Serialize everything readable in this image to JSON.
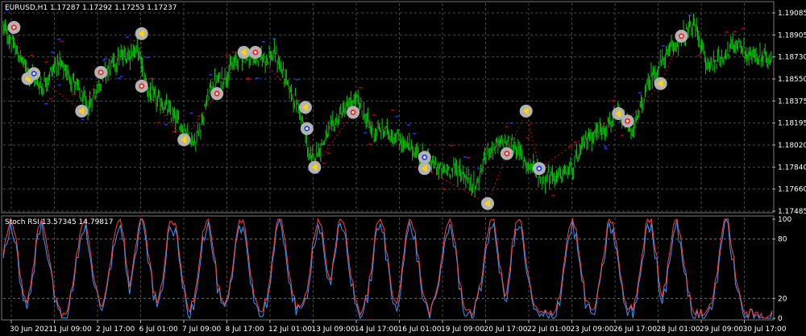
{
  "chart_data": [
    {
      "type": "candlestick",
      "title": "EURUSD,H1  1.17287 1.17292 1.17253 1.17237",
      "symbol": "EURUSD",
      "timeframe": "H1",
      "ohlc_readout": [
        "1.17287",
        "1.17292",
        "1.17253",
        "1.17237"
      ],
      "ylim": [
        1.17485,
        1.19085
      ],
      "y_ticks": [
        "1.19085",
        "1.18905",
        "1.18730",
        "1.18550",
        "1.18375",
        "1.18195",
        "1.18020",
        "1.17840",
        "1.17660",
        "1.17485"
      ],
      "x_ticks": [
        "30 Jun 2021",
        "1 Jul 09:00",
        "2 Jul 17:00",
        "6 Jul 01:00",
        "7 Jul 09:00",
        "8 Jul 17:00",
        "12 Jul 01:00",
        "13 Jul 09:00",
        "14 Jul 17:00",
        "16 Jul 01:00",
        "19 Jul 09:00",
        "20 Jul 17:00",
        "22 Jul 01:00",
        "23 Jul 09:00",
        "26 Jul 17:00",
        "28 Jul 01:00",
        "29 Jul 09:00",
        "30 Jul 17:00"
      ],
      "grid": true,
      "price_path": [
        [
          0,
          1.1893
        ],
        [
          0.03,
          1.186
        ],
        [
          0.05,
          1.1845
        ],
        [
          0.07,
          1.1865
        ],
        [
          0.09,
          1.1852
        ],
        [
          0.11,
          1.1828
        ],
        [
          0.13,
          1.1855
        ],
        [
          0.15,
          1.1868
        ],
        [
          0.175,
          1.1875
        ],
        [
          0.19,
          1.184
        ],
        [
          0.21,
          1.183
        ],
        [
          0.235,
          1.1812
        ],
        [
          0.25,
          1.18
        ],
        [
          0.27,
          1.1845
        ],
        [
          0.29,
          1.1855
        ],
        [
          0.31,
          1.1872
        ],
        [
          0.33,
          1.1868
        ],
        [
          0.355,
          1.187
        ],
        [
          0.375,
          1.184
        ],
        [
          0.385,
          1.1828
        ],
        [
          0.4,
          1.1785
        ],
        [
          0.42,
          1.1805
        ],
        [
          0.44,
          1.1825
        ],
        [
          0.46,
          1.1835
        ],
        [
          0.48,
          1.181
        ],
        [
          0.5,
          1.181
        ],
        [
          0.52,
          1.18
        ],
        [
          0.545,
          1.179
        ],
        [
          0.57,
          1.1778
        ],
        [
          0.59,
          1.178
        ],
        [
          0.615,
          1.1765
        ],
        [
          0.63,
          1.1795
        ],
        [
          0.66,
          1.1802
        ],
        [
          0.68,
          1.1785
        ],
        [
          0.7,
          1.1775
        ],
        [
          0.72,
          1.1773
        ],
        [
          0.74,
          1.178
        ],
        [
          0.76,
          1.1805
        ],
        [
          0.78,
          1.1812
        ],
        [
          0.8,
          1.1822
        ],
        [
          0.82,
          1.181
        ],
        [
          0.84,
          1.185
        ],
        [
          0.86,
          1.1868
        ],
        [
          0.875,
          1.188
        ],
        [
          0.9,
          1.1895
        ],
        [
          0.915,
          1.1862
        ],
        [
          0.935,
          1.187
        ],
        [
          0.955,
          1.188
        ],
        [
          0.97,
          1.187
        ],
        [
          1,
          1.1868
        ]
      ],
      "signals": [
        {
          "x": 0.014,
          "price": 1.1893,
          "kind": "sell"
        },
        {
          "x": 0.032,
          "price": 1.1852,
          "kind": "buy"
        },
        {
          "x": 0.04,
          "price": 1.1856,
          "kind": "buy-blue"
        },
        {
          "x": 0.102,
          "price": 1.1826,
          "kind": "buy"
        },
        {
          "x": 0.127,
          "price": 1.1857,
          "kind": "sell"
        },
        {
          "x": 0.18,
          "price": 1.1888,
          "kind": "buy"
        },
        {
          "x": 0.18,
          "price": 1.1846,
          "kind": "sell"
        },
        {
          "x": 0.235,
          "price": 1.1803,
          "kind": "buy"
        },
        {
          "x": 0.278,
          "price": 1.184,
          "kind": "sell"
        },
        {
          "x": 0.313,
          "price": 1.1873,
          "kind": "buy"
        },
        {
          "x": 0.328,
          "price": 1.1873,
          "kind": "sell"
        },
        {
          "x": 0.393,
          "price": 1.1829,
          "kind": "buy"
        },
        {
          "x": 0.395,
          "price": 1.1812,
          "kind": "buy-blue"
        },
        {
          "x": 0.405,
          "price": 1.1781,
          "kind": "buy"
        },
        {
          "x": 0.455,
          "price": 1.1825,
          "kind": "sell"
        },
        {
          "x": 0.548,
          "price": 1.1789,
          "kind": "sell-blue"
        },
        {
          "x": 0.548,
          "price": 1.178,
          "kind": "buy"
        },
        {
          "x": 0.63,
          "price": 1.1752,
          "kind": "buy"
        },
        {
          "x": 0.655,
          "price": 1.1792,
          "kind": "sell"
        },
        {
          "x": 0.68,
          "price": 1.1826,
          "kind": "buy"
        },
        {
          "x": 0.697,
          "price": 1.178,
          "kind": "sell-blue"
        },
        {
          "x": 0.8,
          "price": 1.1824,
          "kind": "buy"
        },
        {
          "x": 0.812,
          "price": 1.1818,
          "kind": "sell"
        },
        {
          "x": 0.855,
          "price": 1.1848,
          "kind": "buy"
        },
        {
          "x": 0.882,
          "price": 1.1886,
          "kind": "sell"
        }
      ],
      "colors": {
        "background": "#000000",
        "candle": "#00cc00",
        "grid": "#4a4a4a",
        "sar": "#1a3aff",
        "zigzag": "#e00000",
        "marker": "#b3b3b3"
      }
    },
    {
      "type": "line",
      "title": "Stoch RSI 13.57345 14.79817",
      "indicator": "Stoch RSI",
      "readout": [
        "13.57345",
        "14.79817"
      ],
      "ylim": [
        0,
        100
      ],
      "y_ticks": [
        "100",
        "80",
        "20",
        "0"
      ],
      "levels": [
        80,
        20
      ],
      "series": [
        {
          "color": "#ff4040"
        },
        {
          "color": "#3399ff"
        }
      ],
      "cycle_peaks": [
        0.01,
        0.05,
        0.105,
        0.15,
        0.18,
        0.22,
        0.265,
        0.31,
        0.36,
        0.41,
        0.44,
        0.49,
        0.53,
        0.58,
        0.635,
        0.67,
        0.74,
        0.79,
        0.84,
        0.875,
        0.94
      ]
    }
  ]
}
